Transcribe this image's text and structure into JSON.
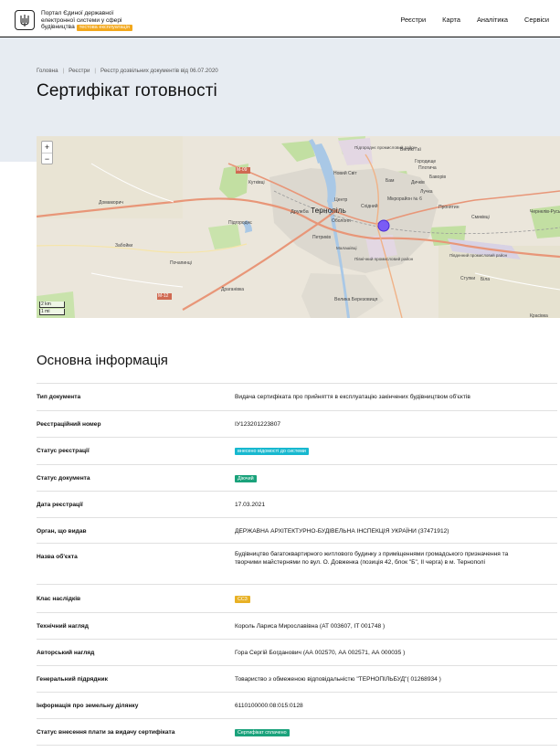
{
  "header": {
    "brand_line1": "Портал Єдиної державної",
    "brand_line2": "електронної системи у сфері",
    "brand_line3": "будівництва",
    "beta_label": "тестова експлуатація",
    "nav": [
      "Реєстри",
      "Карта",
      "Аналітика",
      "Сервіси"
    ]
  },
  "breadcrumbs": [
    "Головна",
    "Реєстри",
    "Реєстр дозвільних документів від 06.07.2020"
  ],
  "page_title": "Сертифікат готовності",
  "map": {
    "zoom_in": "+",
    "zoom_out": "−",
    "scale_km": "2 km",
    "scale_mi": "1 mi",
    "labels": [
      "Тернопіль",
      "Кутківці",
      "Дружба",
      "Новий Світ",
      "Центр",
      "Оболоня",
      "Східний",
      "Мікрорайон № 6",
      "Бам",
      "Підгороднє",
      "Петриків",
      "Пронятин",
      "Велика Березовиця",
      "Ступки",
      "Домаморич",
      "Забойки",
      "Почапинці",
      "Драганівка",
      "Городище",
      "Великі Гаї",
      "Плотича",
      "Лучка",
      "Смиківці",
      "Чернелів-Руський",
      "Красівка",
      "Дичків",
      "Біла",
      "Баворів",
      "Малашівці",
      "Підгороднє промисловий район",
      "Північний промисловий район",
      "Південний промисловий район",
      "Мікрорайон аеропорт Тернопіль"
    ],
    "roads": [
      "M-09",
      "M-12",
      "M-19"
    ],
    "colors": {
      "water": "#a9c8e6",
      "forest": "#c4dfa4",
      "urban": "#dcd8d0",
      "road": "#e89678",
      "marker": "#7a5cf5"
    }
  },
  "section_title": "Основна інформація",
  "info": {
    "doc_type_label": "Тип документа",
    "doc_type": "Видача сертифіката про прийняття в експлуатацію закінчених будівництвом об'єктів",
    "reg_number_label": "Реєстраційний номер",
    "reg_number": "ІУ123201223807",
    "reg_status_label": "Статус реєстрації",
    "reg_status": "внесено відомості до системи",
    "doc_status_label": "Статус документа",
    "doc_status": "Діючий",
    "reg_date_label": "Дата реєстрації",
    "reg_date": "17.03.2021",
    "issuer_label": "Орган, що видав",
    "issuer": "ДЕРЖАВНА АРХІТЕКТУРНО-БУДІВЕЛЬНА ІНСПЕКЦІЯ УКРАЇНИ (37471912)",
    "object_label": "Назва об'єкта",
    "object": "Будівництво багатоквартирного житлового будинку з приміщеннями громадського призначення та творчими майстернями по вул. О. Довженка (позиція 42, блок \"Б\", ІІ черга) в м. Тернополі",
    "class_label": "Клас наслідків",
    "class": "СС3",
    "tech_label": "Технічний нагляд",
    "tech": "Король Лариса Мирославівна (АТ 003607, ІТ 001748 )",
    "author_label": "Авторський нагляд",
    "author": "Гора Сергій Богданович (АА 002570, АА 002571, АА 000035 )",
    "contractor_label": "Генеральний підрядник",
    "contractor": "Товариство з обмеженою відповідальністю \"ТЕРНОПІЛЬБУД\"( 01268934 )",
    "land_label": "Інформація про земельну ділянку",
    "land": "6110100000:08:015:0128",
    "fee_label": "Статус внесення плати за видачу сертифіката",
    "fee": "Сертифікат сплачено"
  }
}
